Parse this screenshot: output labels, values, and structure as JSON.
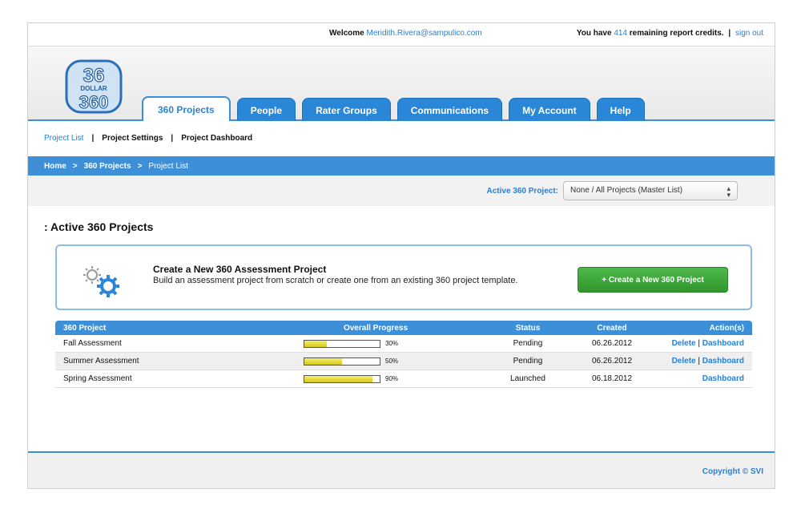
{
  "topbar": {
    "welcome_prefix": "Welcome",
    "user_email": "Meridith.Rivera@sampulico.com",
    "credits_prefix": "You have",
    "credits_count": "414",
    "credits_suffix": "remaining report credits.",
    "separator": "|",
    "sign_out": "sign out"
  },
  "logo": {
    "line1": "36",
    "line2": "DOLLAR",
    "line3": "360"
  },
  "tabs": [
    {
      "label": "360 Projects",
      "active": true
    },
    {
      "label": "People"
    },
    {
      "label": "Rater Groups"
    },
    {
      "label": "Communications"
    },
    {
      "label": "My Account"
    },
    {
      "label": "Help"
    }
  ],
  "subnav": {
    "items": [
      "Project List",
      "Project Settings",
      "Project Dashboard"
    ],
    "separator": "|"
  },
  "breadcrumb": {
    "items": [
      "Home",
      "360 Projects",
      "Project List"
    ],
    "arrow": ">"
  },
  "project_select": {
    "label": "Active 360 Project:",
    "value": "None / All Projects (Master List)"
  },
  "section_title": ": Active 360 Projects",
  "create": {
    "title": "Create a New 360 Assessment Project",
    "description": "Build an assessment project from scratch or create one from an existing 360 project template.",
    "button": "+ Create a New 360 Project"
  },
  "table": {
    "headers": [
      "360 Project",
      "Overall Progress",
      "Status",
      "Created",
      "Action(s)"
    ],
    "rows": [
      {
        "name": "Fall Assessment",
        "progress": 30,
        "progress_label": "30%",
        "status": "Pending",
        "created": "06.26.2012",
        "actions": [
          "Delete",
          "Dashboard"
        ]
      },
      {
        "name": "Summer Assessment",
        "progress": 50,
        "progress_label": "50%",
        "status": "Pending",
        "created": "06.26.2012",
        "actions": [
          "Delete",
          "Dashboard"
        ]
      },
      {
        "name": "Spring Assessment",
        "progress": 90,
        "progress_label": "90%",
        "status": "Launched",
        "created": "06.18.2012",
        "actions": [
          "Dashboard"
        ]
      }
    ],
    "action_separator": "|"
  },
  "footer": {
    "copyright": "Copyright © SVI"
  },
  "colors": {
    "primary_blue": "#3d8fd8",
    "link_blue": "#2a7fd4",
    "create_green": "#3ca839",
    "progress_yellow": "#e8de3a"
  }
}
